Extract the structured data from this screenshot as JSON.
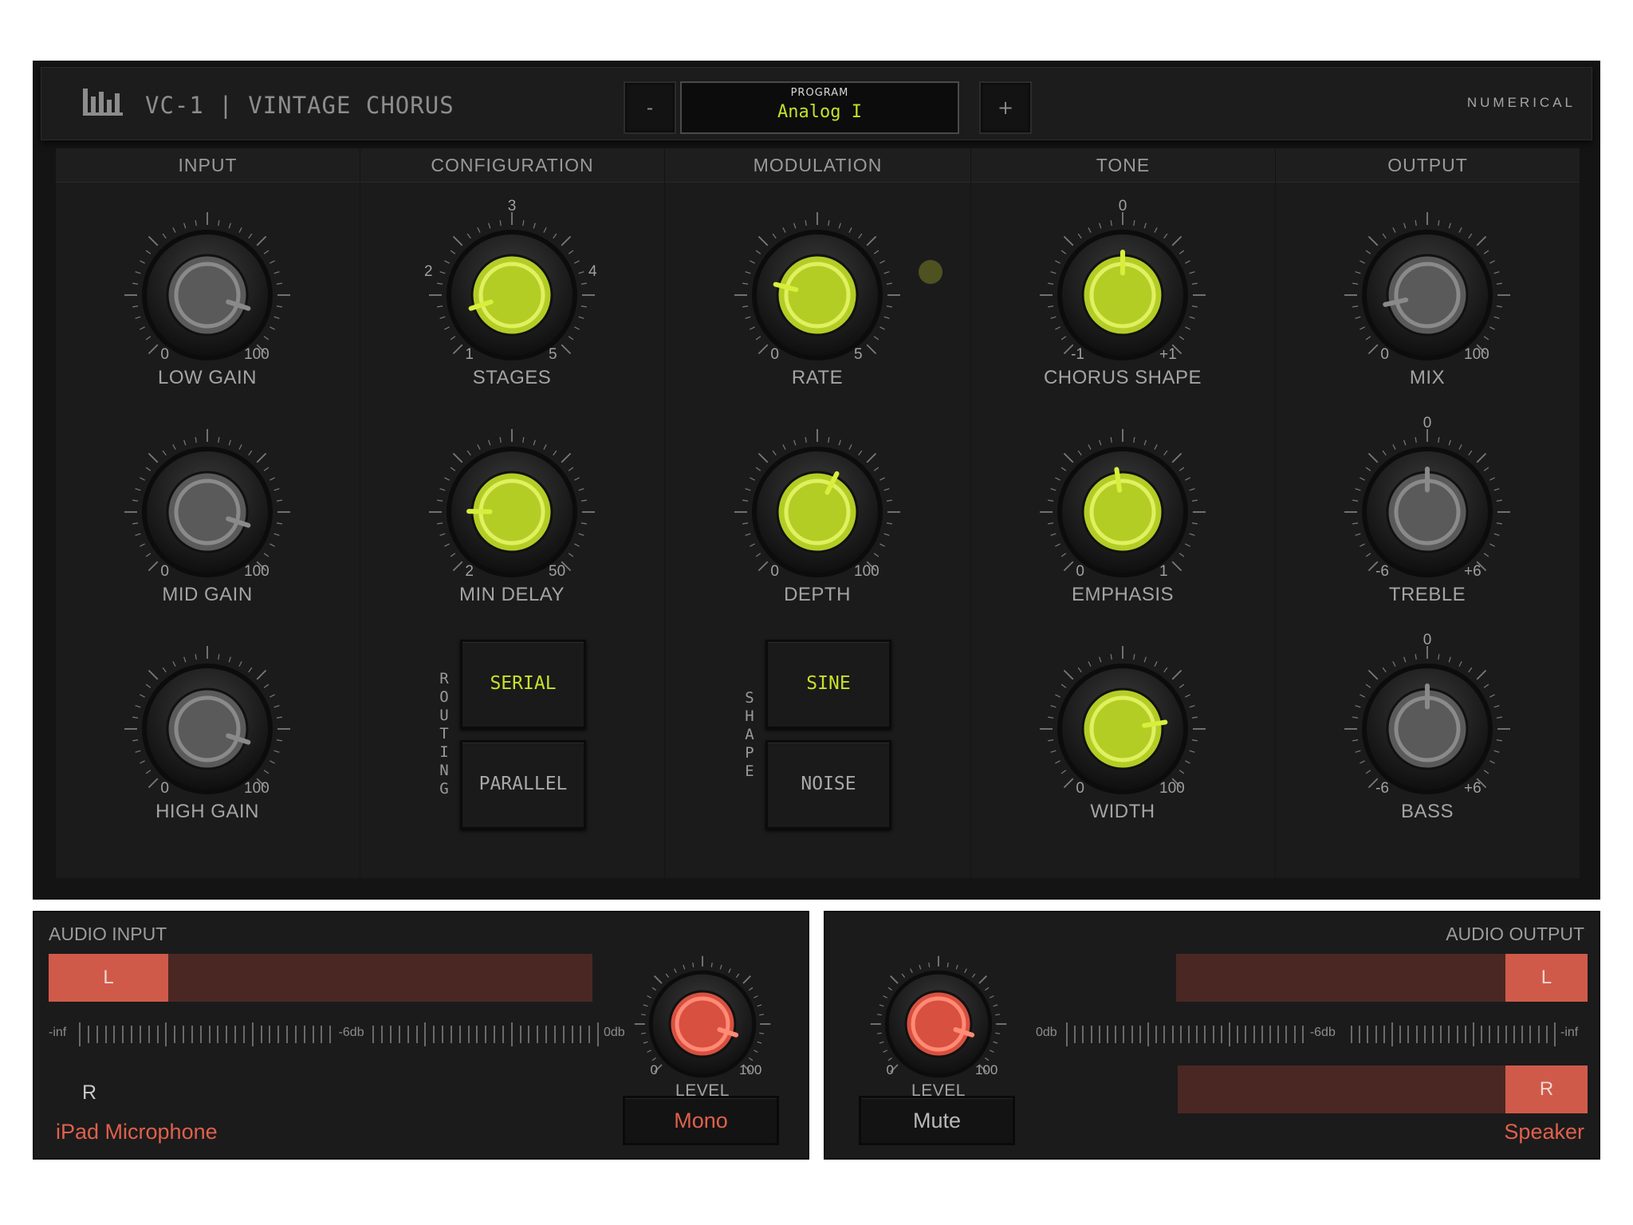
{
  "header": {
    "title": "VC-1 | VINTAGE CHORUS",
    "logo_icon": "bars-logo-icon",
    "program_label": "PROGRAM",
    "program_name": "Analog I",
    "prev_label": "-",
    "next_label": "+",
    "brand": "NUMERICAL"
  },
  "colors": {
    "accent_green": "#c6e02a",
    "accent_red": "#e0604c",
    "meter_bg": "#4a2723",
    "meter_fill": "#d05a4a"
  },
  "sections": {
    "input": "INPUT",
    "configuration": "CONFIGURATION",
    "modulation": "MODULATION",
    "tone": "TONE",
    "output": "OUTPUT"
  },
  "knobs": {
    "low_gain": {
      "name": "LOW GAIN",
      "min": "0",
      "max": "100",
      "value_fraction": 0.9,
      "style": "grey"
    },
    "mid_gain": {
      "name": "MID GAIN",
      "min": "0",
      "max": "100",
      "value_fraction": 0.9,
      "style": "grey"
    },
    "high_gain": {
      "name": "HIGH GAIN",
      "min": "0",
      "max": "100",
      "value_fraction": 0.9,
      "style": "grey"
    },
    "stages": {
      "name": "STAGES",
      "min": "1",
      "max": "5",
      "top": "3",
      "left": "2",
      "right": "4",
      "value_fraction": 0.1,
      "style": "green"
    },
    "min_delay": {
      "name": "MIN DELAY",
      "min": "2",
      "max": "50",
      "value_fraction": 0.17,
      "style": "green"
    },
    "rate": {
      "name": "RATE",
      "min": "0",
      "max": "5",
      "value_fraction": 0.22,
      "style": "green"
    },
    "depth": {
      "name": "DEPTH",
      "min": "0",
      "max": "100",
      "value_fraction": 0.6,
      "style": "green"
    },
    "chorus_shape": {
      "name": "CHORUS SHAPE",
      "min": "-1",
      "max": "+1",
      "top": "0",
      "value_fraction": 0.5,
      "style": "green"
    },
    "emphasis": {
      "name": "EMPHASIS",
      "min": "0",
      "max": "1",
      "value_fraction": 0.47,
      "style": "green"
    },
    "width": {
      "name": "WIDTH",
      "min": "0",
      "max": "100",
      "value_fraction": 0.8,
      "style": "green"
    },
    "mix": {
      "name": "MIX",
      "min": "0",
      "max": "100",
      "value_fraction": 0.12,
      "style": "grey"
    },
    "treble": {
      "name": "TREBLE",
      "min": "-6",
      "max": "+6",
      "top": "0",
      "value_fraction": 0.5,
      "style": "grey"
    },
    "bass": {
      "name": "BASS",
      "min": "-6",
      "max": "+6",
      "top": "0",
      "value_fraction": 0.5,
      "style": "grey"
    }
  },
  "routing": {
    "label": "ROUTING",
    "options": [
      "SERIAL",
      "PARALLEL"
    ],
    "selected": "SERIAL"
  },
  "shape": {
    "label": "SHAPE",
    "options": [
      "SINE",
      "NOISE"
    ],
    "selected": "SINE"
  },
  "audio_input": {
    "title": "AUDIO INPUT",
    "left_label": "L",
    "left_level": 0.22,
    "right_label": "R",
    "scale_min": "-inf",
    "scale_mid": "-6db",
    "scale_max": "0db",
    "level_knob": {
      "name": "LEVEL",
      "min": "0",
      "max": "100",
      "value_fraction": 0.9
    },
    "mode_button": "Mono",
    "device": "iPad Microphone"
  },
  "audio_output": {
    "title": "AUDIO OUTPUT",
    "left_label": "L",
    "left_level": 0.2,
    "right_label": "R",
    "right_level": 0.2,
    "scale_min": "-inf",
    "scale_mid": "-6db",
    "scale_max": "0db",
    "level_knob": {
      "name": "LEVEL",
      "min": "0",
      "max": "100",
      "value_fraction": 0.9
    },
    "mode_button": "Mute",
    "device": "Speaker"
  }
}
